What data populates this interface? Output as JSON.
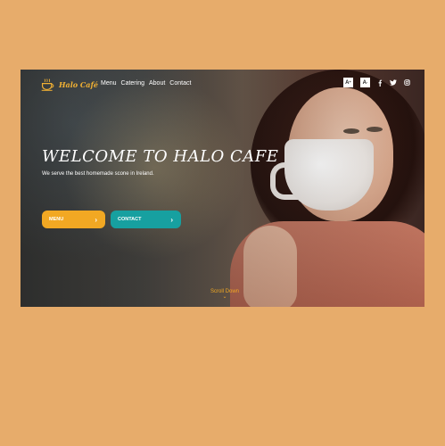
{
  "brand": {
    "name": "Halo Café"
  },
  "nav": {
    "items": [
      {
        "label": "Menu"
      },
      {
        "label": "Catering"
      },
      {
        "label": "About"
      },
      {
        "label": "Contact"
      }
    ]
  },
  "toolbar": {
    "font_increase_label": "A",
    "font_increase_sup": "+",
    "font_decrease_label": "A",
    "font_decrease_sup": "-",
    "social_icons": [
      "facebook-icon",
      "twitter-icon",
      "instagram-icon"
    ]
  },
  "hero": {
    "title": "WELCOME TO HALO CAFE",
    "subtitle": "We serve the best homemade scone in Ireland.",
    "buttons": [
      {
        "label": "MENU",
        "color": "#f2a823"
      },
      {
        "label": "CONTACT",
        "color": "#17a0a0"
      }
    ],
    "scroll_label": "Scroll Down"
  },
  "colors": {
    "page_background": "#e7ac6b",
    "brand_accent": "#f2b133"
  }
}
